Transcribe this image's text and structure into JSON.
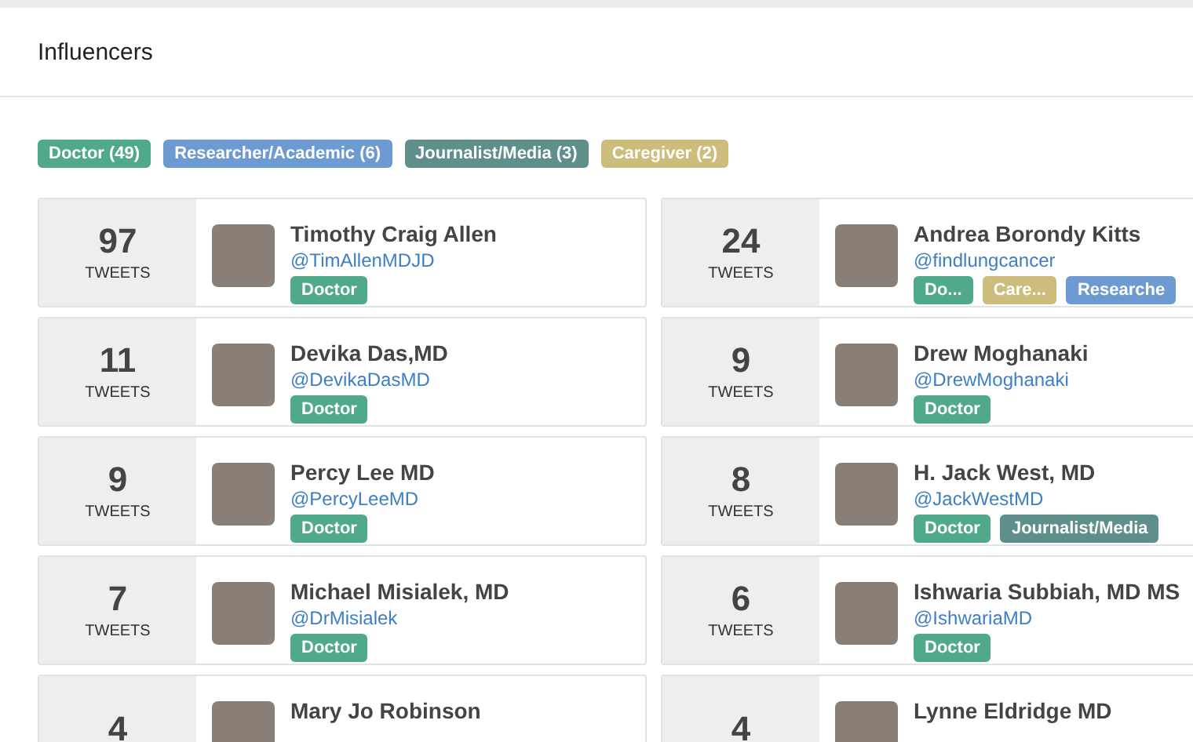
{
  "title": "Influencers",
  "filters": [
    {
      "label": "Doctor (49)",
      "color": "#4fa98a"
    },
    {
      "label": "Researcher/Academic (6)",
      "color": "#6d9ad0"
    },
    {
      "label": "Journalist/Media (3)",
      "color": "#5f8f8b"
    },
    {
      "label": "Caregiver (2)",
      "color": "#cdbd7d"
    }
  ],
  "influencers": [
    {
      "count": "97",
      "unit": "TWEETS",
      "name": "Timothy Craig Allen",
      "handle": "@TimAllenMDJD",
      "tags": [
        {
          "label": "Doctor",
          "color": "#4fa98a"
        }
      ]
    },
    {
      "count": "24",
      "unit": "TWEETS",
      "name": "Andrea Borondy Kitts",
      "handle": "@findlungcancer",
      "tags": [
        {
          "label": "Do...",
          "color": "#4fa98a"
        },
        {
          "label": "Care...",
          "color": "#cdbd7d"
        },
        {
          "label": "Researche",
          "color": "#6d9ad0"
        }
      ]
    },
    {
      "count": "11",
      "unit": "TWEETS",
      "name": "Devika Das,MD",
      "handle": "@DevikaDasMD",
      "tags": [
        {
          "label": "Doctor",
          "color": "#4fa98a"
        }
      ]
    },
    {
      "count": "9",
      "unit": "TWEETS",
      "name": "Drew Moghanaki",
      "handle": "@DrewMoghanaki",
      "tags": [
        {
          "label": "Doctor",
          "color": "#4fa98a"
        }
      ]
    },
    {
      "count": "9",
      "unit": "TWEETS",
      "name": "Percy Lee MD",
      "handle": "@PercyLeeMD",
      "tags": [
        {
          "label": "Doctor",
          "color": "#4fa98a"
        }
      ]
    },
    {
      "count": "8",
      "unit": "TWEETS",
      "name": "H. Jack West, MD",
      "handle": "@JackWestMD",
      "tags": [
        {
          "label": "Doctor",
          "color": "#4fa98a"
        },
        {
          "label": "Journalist/Media",
          "color": "#5f8f8b"
        }
      ]
    },
    {
      "count": "7",
      "unit": "TWEETS",
      "name": "Michael Misialek, MD",
      "handle": "@DrMisialek",
      "tags": [
        {
          "label": "Doctor",
          "color": "#4fa98a"
        }
      ]
    },
    {
      "count": "6",
      "unit": "TWEETS",
      "name": "Ishwaria Subbiah, MD MS",
      "handle": "@IshwariaMD",
      "tags": [
        {
          "label": "Doctor",
          "color": "#4fa98a"
        }
      ]
    },
    {
      "count": "4",
      "name": "Mary Jo Robinson"
    },
    {
      "count": "4",
      "name": "Lynne Eldridge MD"
    }
  ]
}
